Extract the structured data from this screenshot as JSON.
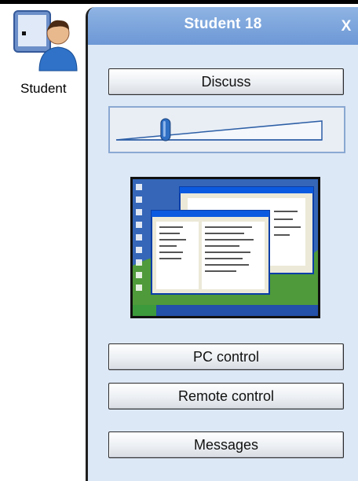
{
  "student_item": {
    "label": "Student",
    "icon": "student-computer-icon"
  },
  "panel": {
    "title": "Student 18",
    "close_label": "X",
    "discuss_label": "Discuss",
    "volume": {
      "level": 0.24,
      "icon": "volume-slider"
    },
    "screen_thumbnail_icon": "desktop-screenshot-thumbnail",
    "pc_control_label": "PC control",
    "remote_control_label": "Remote control",
    "messages_label": "Messages"
  },
  "colors": {
    "header_top": "#8fb4e3",
    "header_bottom": "#6d98d6",
    "panel_bg": "#dde8f6",
    "slider_knob": "#2f6fc4",
    "desktop_blue": "#2a55a5"
  }
}
